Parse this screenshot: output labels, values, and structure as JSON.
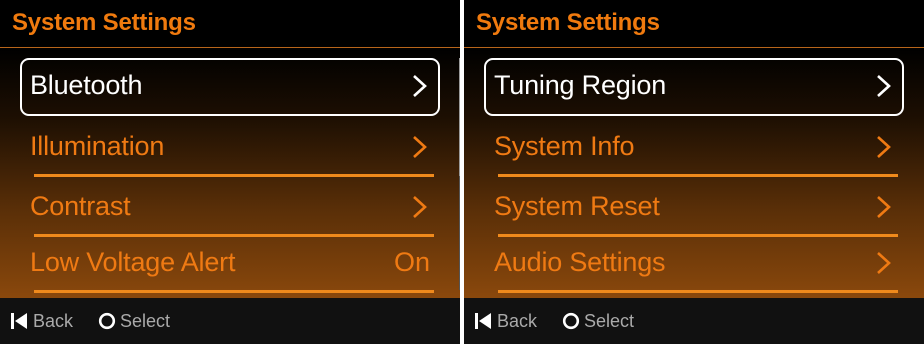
{
  "left_screen": {
    "title": "System Settings",
    "items": [
      {
        "label": "Bluetooth",
        "type": "chevron",
        "selected": true
      },
      {
        "label": "Illumination",
        "type": "chevron"
      },
      {
        "label": "Contrast",
        "type": "chevron"
      },
      {
        "label": "Low Voltage Alert",
        "type": "value",
        "value": "On"
      }
    ],
    "footer": {
      "back_label": "Back",
      "select_label": "Select"
    }
  },
  "right_screen": {
    "title": "System Settings",
    "items": [
      {
        "label": "Tuning Region",
        "type": "chevron",
        "selected": true
      },
      {
        "label": "System Info",
        "type": "chevron"
      },
      {
        "label": "System Reset",
        "type": "chevron"
      },
      {
        "label": "Audio Settings",
        "type": "chevron"
      }
    ],
    "footer": {
      "back_label": "Back",
      "select_label": "Select"
    }
  },
  "colors": {
    "accent": "#ef7a13",
    "selected_text": "#ffffff",
    "footer_text": "#aaaaaa",
    "background": "#000000"
  },
  "icons": {
    "back": "skip-back-icon",
    "select": "circle-select-icon",
    "chevron": "chevron-right-icon"
  }
}
